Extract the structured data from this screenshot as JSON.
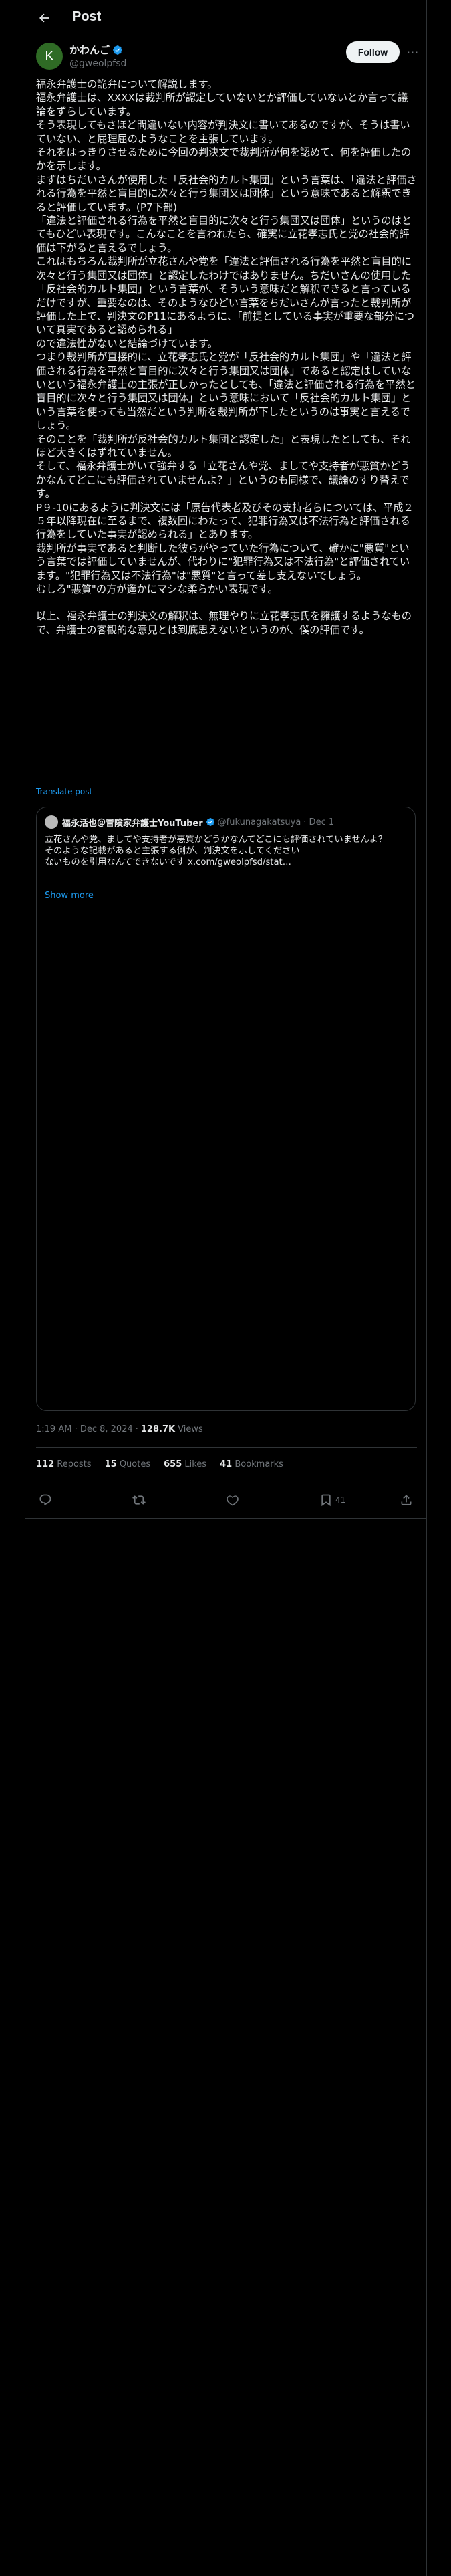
{
  "header": {
    "title": "Post",
    "back_icon": "arrow-left-icon"
  },
  "author": {
    "avatar_letter": "K",
    "name": "かわんご",
    "handle": "@gweolpfsd",
    "verified_icon": "verified-badge-icon",
    "follow_label": "Follow",
    "more_icon": "more-dots-icon",
    "avatar_color": "#2f6b25"
  },
  "post": {
    "paragraphs": [
      "福永弁護士の詭弁について解説します。",
      "福永弁護士は、XXXXは裁判所が認定していないとか評価していないとか言って議論をずらしています。",
      "そう表現してもさほど間違いない内容が判決文に書いてあるのですが、そうは書いていない、と屁理屈のようなことを主張しています。",
      "それをはっきりさせるために今回の判決文で裁判所が何を認めて、何を評価したのかを示します。",
      "まずはちだいさんが使用した「反社会的カルト集団」という言葉は、「違法と評価される行為を平然と盲目的に次々と行う集団又は団体」という意味であると解釈できると評価しています。(P7下部)",
      "「違法と評価される行為を平然と盲目的に次々と行う集団又は団体」というのはとてもひどい表現です。こんなことを言われたら、確実に立花孝志氏と党の社会的評価は下がると言えるでしょう。",
      "これはもちろん裁判所が立花さんや党を「違法と評価される行為を平然と盲目的に次々と行う集団又は団体」と認定したわけではありません。ちだいさんの使用した「反社会的カルト集団」という言葉が、そういう意味だと解釈できると言っているだけですが、重要なのは、そのようなひどい言葉をちだいさんが言ったと裁判所が評価した上で、判決文のP11にあるように、「前提としている事実が重要な部分について真実であると認められる」",
      "ので違法性がないと結論づけています。",
      "つまり裁判所が直接的に、立花孝志氏と党が「反社会的カルト集団」や「違法と評価される行為を平然と盲目的に次々と行う集団又は団体」であると認定はしていないという福永弁護士の主張が正しかったとしても、「違法と評価される行為を平然と盲目的に次々と行う集団又は団体」という意味において「反社会的カルト集団」という言葉を使っても当然だという判断を裁判所が下したというのは事実と言えるでしょう。",
      "そのことを「裁判所が反社会的カルト集団と認定した」と表現したとしても、それほど大きくはずれていません。",
      "そして、福永弁護士がいて強弁する「立花さんや党、ましてや支持者が悪質かどうかなんてどこにも評価されていませんよ？」というのも同様で、議論のすり替えです。",
      "P９-10にあるように判決文には「原告代表者及びその支持者らについては、平成２５年以降現在に至るまで、複数回にわたって、犯罪行為又は不法行為と評価される行為をしていた事実が認められる」とあります。",
      "裁判所が事実であると判断した彼らがやっていた行為について、確かに\"悪質\"という言葉では評価していませんが、代わりに\"犯罪行為又は不法行為\"と評価されています。\"犯罪行為又は不法行為\"は\"悪質\"と言って差し支えないでしょう。",
      "むしろ\"悪質\"の方が遥かにマシな柔らかい表現です。",
      "",
      "以上、福永弁護士の判決文の解釈は、無理やりに立花孝志氏を擁護するようなもので、弁護士の客観的な意見とは到底思えないというのが、僕の評価です。"
    ],
    "translate_label": "Translate post"
  },
  "quoted_post": {
    "name": "福永活也＠冒険家弁護士YouTuber",
    "handle": "@fukunagakatsuya",
    "date": "· Dec 1",
    "lines": [
      "立花さんや党、ましてや支持者が悪質かどうかなんてどこにも評価されていませんよ？",
      "そのような記載があると主張する側が、判決文を示してください",
      "ないものを引用なんてできないです x.com/gweolpfsd/stat…"
    ],
    "show_more_label": "Show more"
  },
  "meta": {
    "time": "1:19 AM · Dec 8, 2024",
    "views_sep": "·",
    "views_count": "128.7K",
    "views_label": "Views"
  },
  "stats": [
    {
      "count": "112",
      "label": "Reposts"
    },
    {
      "count": "15",
      "label": "Quotes"
    },
    {
      "count": "655",
      "label": "Likes"
    },
    {
      "count": "41",
      "label": "Bookmarks"
    }
  ],
  "actions": {
    "reply_icon": "reply-icon",
    "repost_icon": "repost-icon",
    "like_icon": "heart-icon",
    "bookmark_icon": "bookmark-icon",
    "bookmark_count": "41",
    "share_icon": "share-icon"
  },
  "colors": {
    "background": "#000000",
    "text": "#e7e9ea",
    "muted": "#71767b",
    "accent": "#1d9bf0",
    "border": "#2f3336"
  }
}
